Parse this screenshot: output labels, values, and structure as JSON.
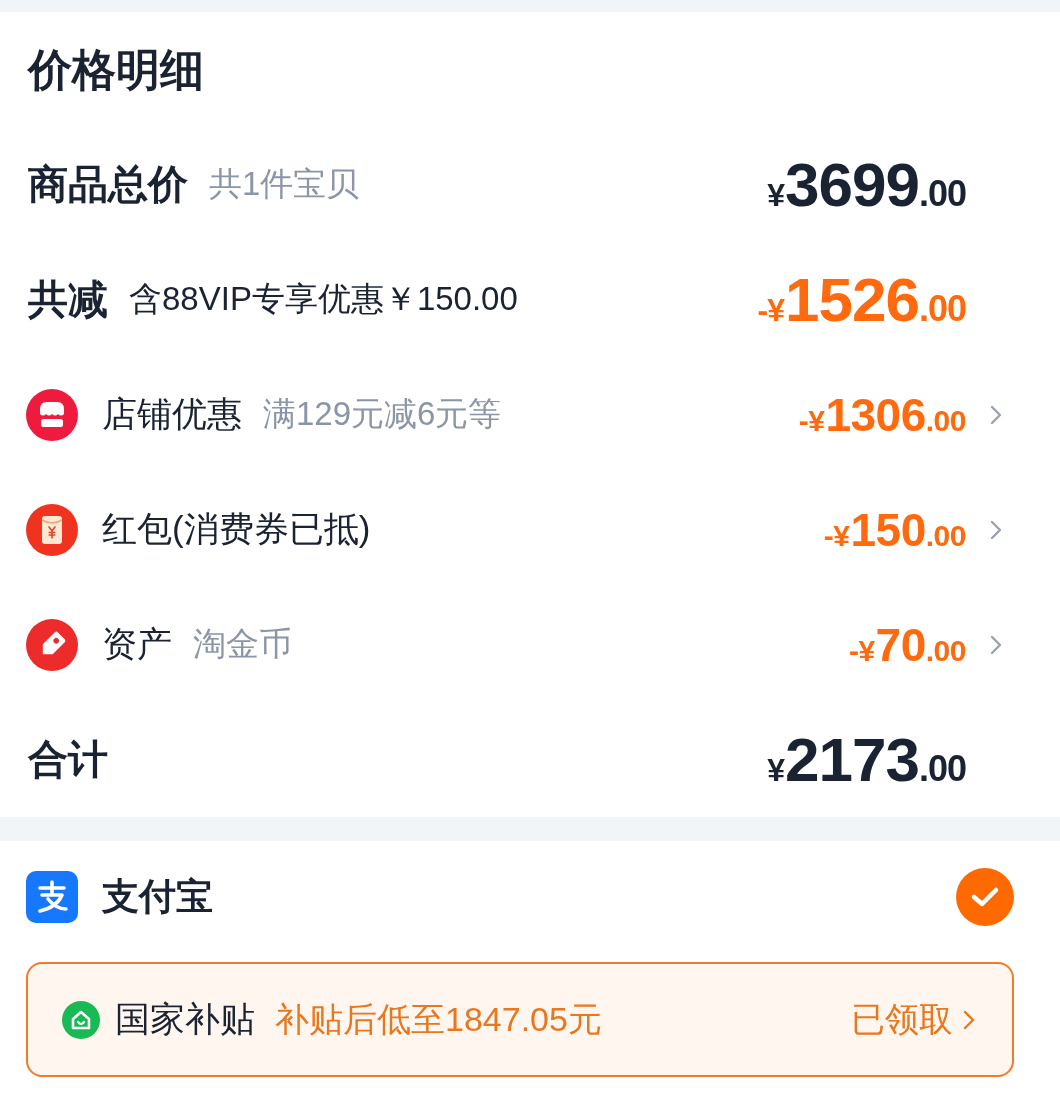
{
  "price_detail": {
    "title": "价格明细",
    "rows": [
      {
        "kind": "subtotal",
        "label": "商品总价",
        "note": "共1件宝贝",
        "amount": {
          "prefix": "¥",
          "integer": "3699",
          "decimal": ".00",
          "highlight": false
        }
      },
      {
        "kind": "reduction",
        "label": "共减",
        "note": "含88VIP专享优惠￥150.00",
        "amount": {
          "prefix": "-¥",
          "integer": "1526",
          "decimal": ".00",
          "highlight": true
        }
      },
      {
        "kind": "store",
        "label": "店铺优惠",
        "note": "满129元减6元等",
        "amount": {
          "prefix": "-¥",
          "integer": "1306",
          "decimal": ".00",
          "highlight": true
        }
      },
      {
        "kind": "packet",
        "label": "红包(消费券已抵)",
        "amount": {
          "prefix": "-¥",
          "integer": "150",
          "decimal": ".00",
          "highlight": true
        }
      },
      {
        "kind": "asset",
        "label": "资产",
        "note": "淘金币",
        "amount": {
          "prefix": "-¥",
          "integer": "70",
          "decimal": ".00",
          "highlight": true
        }
      },
      {
        "kind": "total",
        "label": "合计",
        "amount": {
          "prefix": "¥",
          "integer": "2173",
          "decimal": ".00",
          "highlight": false
        }
      }
    ]
  },
  "payment": {
    "method": "支付宝",
    "selected": true,
    "subsidy": {
      "label": "国家补贴",
      "offer": "补贴后低至1847.05元",
      "status": "已领取"
    }
  }
}
